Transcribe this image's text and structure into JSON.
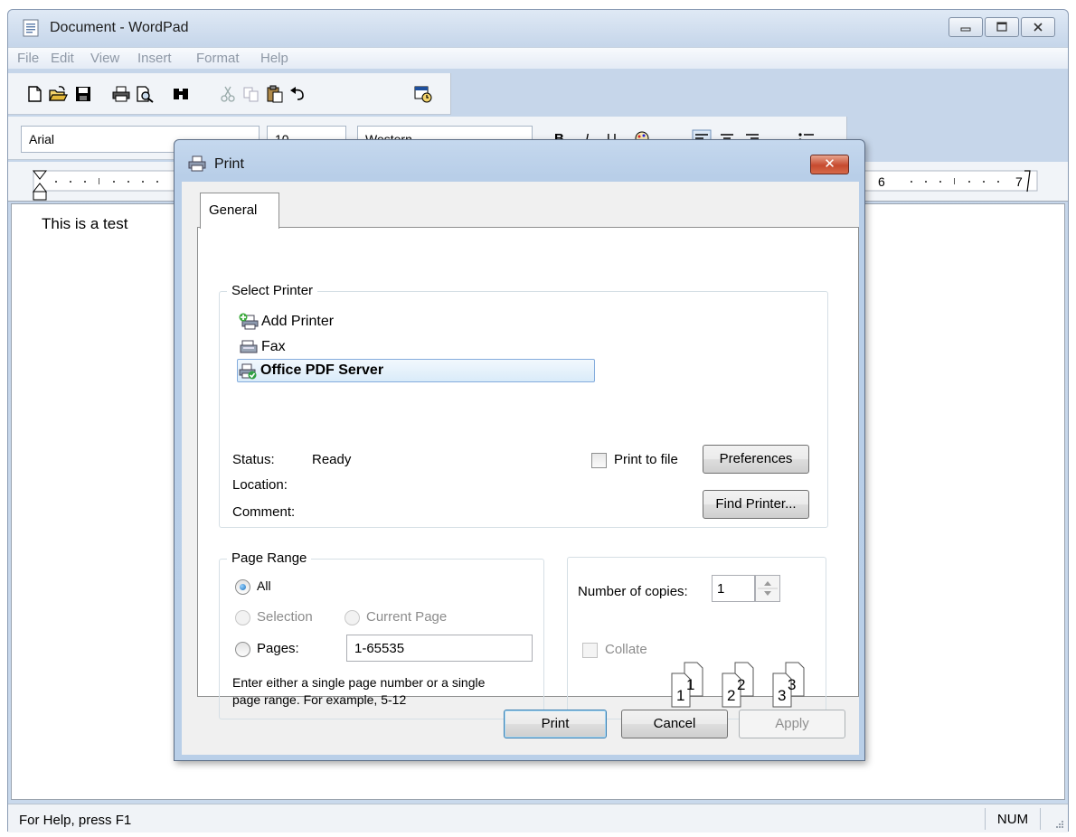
{
  "window": {
    "title": "Document - WordPad",
    "menu": [
      "File",
      "Edit",
      "View",
      "Insert",
      "Format",
      "Help"
    ]
  },
  "format_bar": {
    "font": "Arial",
    "size": "10",
    "script": "Western"
  },
  "ruler": {
    "visible_numbers": [
      "6",
      "7"
    ]
  },
  "document": {
    "text": "This is a test"
  },
  "status_bar": {
    "help": "For Help, press F1",
    "num": "NUM"
  },
  "print_dialog": {
    "title": "Print",
    "close_glyph": "✕",
    "tab": "General",
    "select_printer": {
      "legend": "Select Printer",
      "printers": [
        {
          "name": "Add Printer",
          "icon": "add-printer-icon"
        },
        {
          "name": "Fax",
          "icon": "fax-icon"
        },
        {
          "name": "Office PDF Server",
          "icon": "printer-default-icon",
          "selected": true
        }
      ],
      "status_label": "Status:",
      "status_value": "Ready",
      "location_label": "Location:",
      "comment_label": "Comment:",
      "print_to_file": "Print to file",
      "preferences": "Preferences",
      "find_printer": "Find Printer..."
    },
    "page_range": {
      "legend": "Page Range",
      "all": "All",
      "selection": "Selection",
      "current_page": "Current Page",
      "pages": "Pages:",
      "pages_value": "1-65535",
      "hint_line1": "Enter either a single page number or a single",
      "hint_line2": "page range.  For example, 5-12"
    },
    "copies": {
      "label": "Number of copies:",
      "value": "1",
      "collate": "Collate",
      "page_labels": [
        "1",
        "1",
        "2",
        "2",
        "3",
        "3"
      ]
    },
    "buttons": {
      "print": "Print",
      "cancel": "Cancel",
      "apply": "Apply"
    }
  }
}
